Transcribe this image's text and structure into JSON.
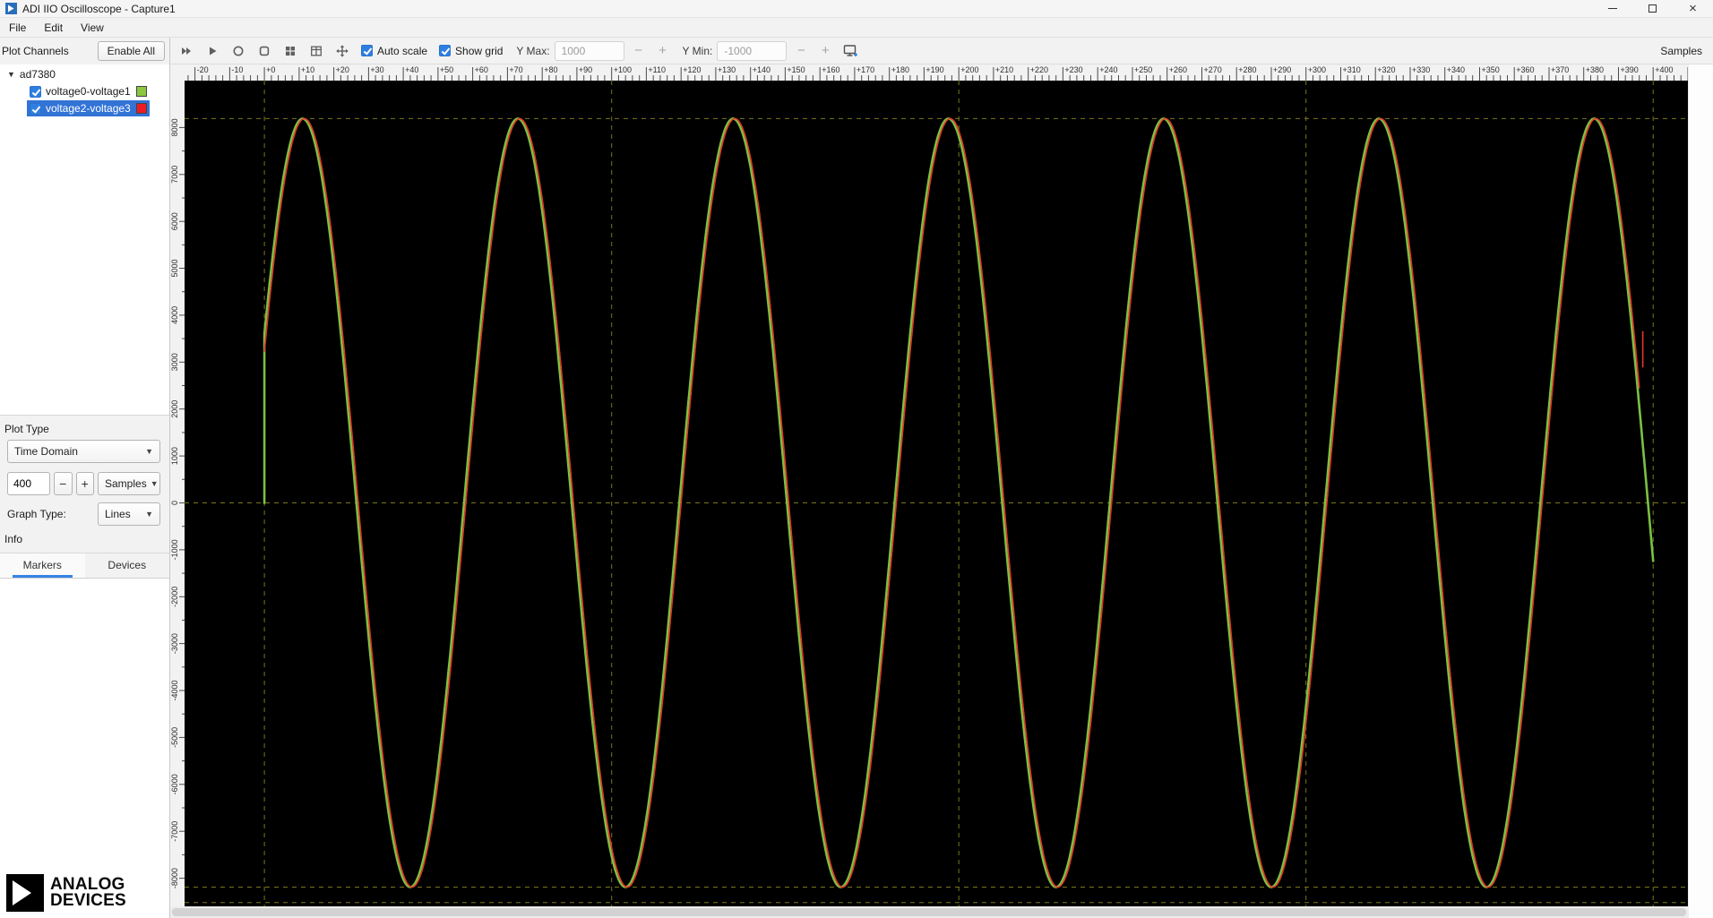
{
  "window": {
    "title": "ADI IIO Oscilloscope - Capture1"
  },
  "menubar": {
    "items": [
      "File",
      "Edit",
      "View"
    ]
  },
  "toolbar": {
    "left_icons": [
      "fast-forward-icon",
      "play-icon",
      "record-icon",
      "stop-icon",
      "grid-view-icon",
      "table-icon",
      "pan-icon"
    ],
    "auto_scale_label": "Auto scale",
    "auto_scale_checked": true,
    "show_grid_label": "Show grid",
    "show_grid_checked": true,
    "y_max_label": "Y Max:",
    "y_max_value": "1000",
    "y_min_label": "Y Min:",
    "y_min_value": "-1000",
    "add_plot_icon": "add-plot-icon",
    "samples_axis_label": "Samples"
  },
  "sidebar": {
    "plot_channels_label": "Plot Channels",
    "enable_all_label": "Enable All",
    "device_tree": [
      {
        "device": "ad7380",
        "expanded": true,
        "channels": [
          {
            "label": "voltage0-voltage1",
            "checked": true,
            "color": "#8dc63f",
            "selected": false
          },
          {
            "label": "voltage2-voltage3",
            "checked": true,
            "color": "#ed1c24",
            "selected": true
          }
        ]
      }
    ],
    "plot_type_label": "Plot Type",
    "plot_type_value": "Time Domain",
    "sample_count_value": "400",
    "sample_unit_value": "Samples",
    "graph_type_label": "Graph Type:",
    "graph_type_value": "Lines",
    "info_label": "Info",
    "tabs": [
      {
        "label": "Markers",
        "active": true
      },
      {
        "label": "Devices",
        "active": false
      }
    ],
    "logo": {
      "line1": "ANALOG",
      "line2": "DEVICES"
    }
  },
  "chart_data": {
    "type": "line",
    "xlabel": "Samples",
    "background": "#000000",
    "x_view": {
      "min": -23,
      "max": 410
    },
    "y_view": {
      "min": -8600,
      "max": 9000
    },
    "x_axis": {
      "major_tick": 10,
      "minor_tick": 2,
      "label_prefix_positive": "+"
    },
    "y_axis": {
      "tick_min": -8000,
      "tick_max": 8000,
      "tick_step": 1000,
      "minor_step": 500
    },
    "grid": {
      "show": true,
      "color": "#78781e",
      "dash": "5 5",
      "vertical_lines_x": [
        0,
        100,
        200,
        300,
        400
      ],
      "horizontal_lines_y": [
        8190,
        0,
        -8190,
        -8520
      ]
    },
    "series": [
      {
        "name": "voltage0-voltage1",
        "color": "#7bc143",
        "stroke_width": 2.6,
        "waveform": "sine",
        "amplitude": 8190,
        "period": 62,
        "peak_x": 11,
        "x_start": 0,
        "x_end": 400,
        "start_spike": {
          "x": 0,
          "from": 0,
          "to": 3600
        }
      },
      {
        "name": "voltage2-voltage3",
        "color": "#e2362b",
        "stroke_width": 1.6,
        "waveform": "sine",
        "amplitude": 8190,
        "period": 62,
        "peak_x": 11.5,
        "x_start": 0,
        "x_end": 396,
        "end_spike": {
          "x": 397,
          "from": 2900,
          "to": 3650
        }
      }
    ]
  }
}
